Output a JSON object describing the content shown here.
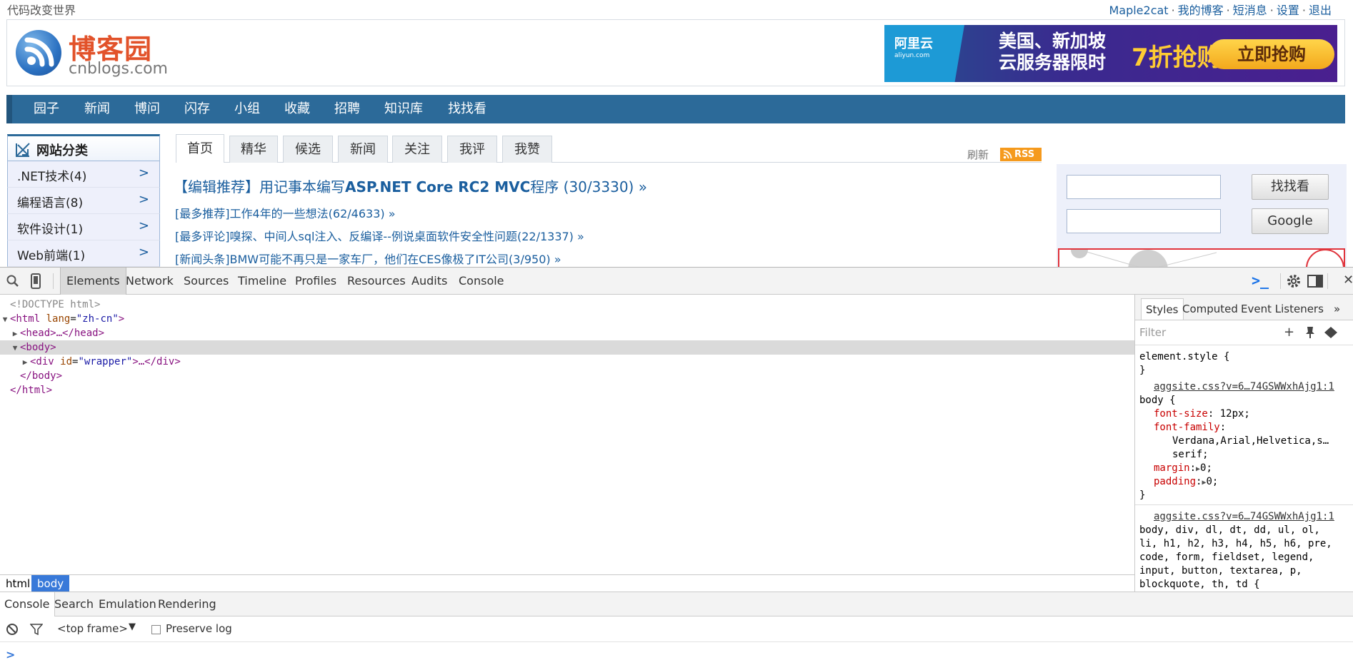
{
  "site": {
    "slogan": "代码改变世界",
    "toplinks": [
      "Maple2cat",
      "我的博客",
      "短消息",
      "设置",
      "退出"
    ],
    "logo_name": "博客园",
    "logo_domain": "cnblogs.com",
    "ad": {
      "logo_text": "阿里云",
      "logo_sub": "aliyun.com",
      "line1": "美国、新加坡",
      "line2": "云服务器限时",
      "sale": "7折抢购",
      "button": "立即抢购"
    },
    "nav": [
      "园子",
      "新闻",
      "博问",
      "闪存",
      "小组",
      "收藏",
      "招聘",
      "知识库",
      "找找看"
    ],
    "category": {
      "title": "网站分类",
      "items": [
        ".NET技术(4)",
        "编程语言(8)",
        "软件设计(1)",
        "Web前端(1)"
      ]
    },
    "tabs": [
      "首页",
      "精华",
      "候选",
      "新闻",
      "关注",
      "我评",
      "我赞"
    ],
    "refresh": "刷新",
    "rss": "RSS",
    "headline": {
      "prefix": "【编辑推荐】用记事本编写",
      "bold": "ASP.NET Core RC2 MVC",
      "suffix": "程序 (30/3330) »"
    },
    "news": [
      "[最多推荐]工作4年的一些想法(62/4633) »",
      "[最多评论]嗅探、中间人sql注入、反编译--例说桌面软件安全性问题(22/1337) »",
      "[新闻头条]BMW可能不再只是一家车厂，他们在CES像极了IT公司(3/950) »"
    ],
    "search_button": "找找看",
    "google_button": "Google"
  },
  "devtools": {
    "tabs": [
      "Elements",
      "Network",
      "Sources",
      "Timeline",
      "Profiles",
      "Resources",
      "Audits",
      "Console"
    ],
    "dom": {
      "doctype": "<!DOCTYPE html>",
      "html_open_tag": "<html",
      "html_attr": "lang",
      "html_attr_val": "\"zh-cn\"",
      "head": "<head>…</head>",
      "body_open": "<body>",
      "div_open": "<div",
      "div_attr": "id",
      "div_attr_val": "\"wrapper\"",
      "div_close": ">…</div>",
      "body_close": "</body>",
      "html_close": "</html>",
      "gt": ">"
    },
    "breadcrumb": [
      "html",
      "body"
    ],
    "styles_tabs": [
      "Styles",
      "Computed",
      "Event Listeners",
      "»"
    ],
    "filter_placeholder": "Filter",
    "styles": {
      "element_style": "element.style {",
      "close_brace": "}",
      "source1": "aggsite.css?v=6…74GSWWxhAjg1:1",
      "sel1": "body {",
      "p1": "font-size",
      "v1": "12px;",
      "p2": "font-family",
      "v2a": "Verdana,Arial,Helvetica,s…",
      "v2b": "serif;",
      "p3": "margin",
      "v3": "0;",
      "p4": "padding",
      "v4": "0;",
      "source2": "aggsite.css?v=6…74GSWWxhAjg1:1",
      "sel2a": "body, div, dl, dt, dd, ul, ol,",
      "sel2b": "li, h1, h2, h3, h4, h5, h6, pre,",
      "sel2c": "code, form, fieldset, legend,",
      "sel2d": "input, button, textarea, p,",
      "sel2e": "blockquote, th, td {"
    },
    "drawer_tabs": [
      "Console",
      "Search",
      "Emulation",
      "Rendering"
    ],
    "frame": "<top frame>",
    "preserve_log": "Preserve log",
    "prompt": ">"
  }
}
